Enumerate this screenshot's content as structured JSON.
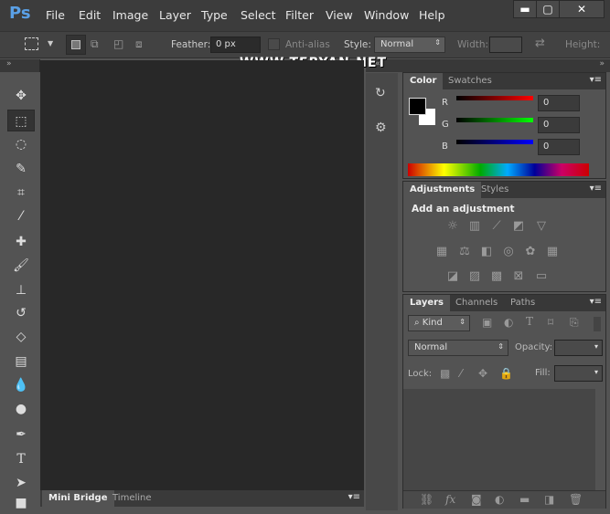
{
  "app": {
    "logo": "Ps",
    "menu": [
      "File",
      "Edit",
      "Image",
      "Layer",
      "Type",
      "Select",
      "Filter",
      "View",
      "Window",
      "Help"
    ],
    "window_controls": [
      "minimize",
      "maximize",
      "close"
    ]
  },
  "watermark": "WWW.TEBYAN.NET",
  "options": {
    "feather_label": "Feather:",
    "feather_value": "0 px",
    "antialias_label": "Anti-alias",
    "style_label": "Style:",
    "style_value": "Normal",
    "width_label": "Width:",
    "height_label": "Height:"
  },
  "tools": [
    "move",
    "rectangular-marquee",
    "lasso",
    "quick-selection",
    "crop",
    "eyedropper",
    "spot-healing",
    "brush",
    "clone-stamp",
    "history-brush",
    "eraser",
    "gradient",
    "blur",
    "dodge",
    "pen",
    "type",
    "path-selection",
    "rectangle"
  ],
  "bottom_tabs": [
    "Mini Bridge",
    "Timeline"
  ],
  "color_panel": {
    "tabs": [
      "Color",
      "Swatches"
    ],
    "channels": [
      {
        "label": "R",
        "value": "0",
        "color": "#ff0000"
      },
      {
        "label": "G",
        "value": "0",
        "color": "#00ff00"
      },
      {
        "label": "B",
        "value": "0",
        "color": "#0000ff"
      }
    ],
    "foreground": "#000000",
    "background": "#ffffff"
  },
  "adjustments_panel": {
    "tabs": [
      "Adjustments",
      "Styles"
    ],
    "heading": "Add an adjustment"
  },
  "layers_panel": {
    "tabs": [
      "Layers",
      "Channels",
      "Paths"
    ],
    "filter_kind": "Kind",
    "blend_mode": "Normal",
    "opacity_label": "Opacity:",
    "lock_label": "Lock:",
    "fill_label": "Fill:",
    "footer_icons": [
      "link",
      "fx",
      "mask",
      "adjustment",
      "group",
      "new-layer",
      "trash"
    ]
  }
}
